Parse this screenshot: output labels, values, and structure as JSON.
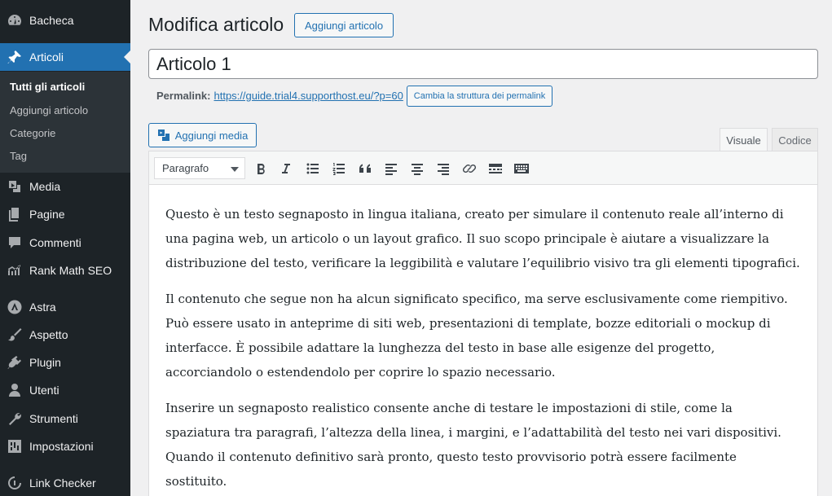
{
  "sidebar": {
    "items": [
      {
        "label": "Bacheca",
        "icon": "dashboard-icon"
      },
      {
        "label": "Articoli",
        "icon": "pin-icon"
      },
      {
        "label": "Media",
        "icon": "media-icon"
      },
      {
        "label": "Pagine",
        "icon": "pages-icon"
      },
      {
        "label": "Commenti",
        "icon": "comments-icon"
      },
      {
        "label": "Rank Math SEO",
        "icon": "chart-icon"
      },
      {
        "label": "Astra",
        "icon": "astra-icon"
      },
      {
        "label": "Aspetto",
        "icon": "brush-icon"
      },
      {
        "label": "Plugin",
        "icon": "plugin-icon"
      },
      {
        "label": "Utenti",
        "icon": "user-icon"
      },
      {
        "label": "Strumenti",
        "icon": "wrench-icon"
      },
      {
        "label": "Impostazioni",
        "icon": "settings-icon"
      },
      {
        "label": "Link Checker",
        "icon": "link-icon"
      }
    ],
    "submenu": [
      "Tutti gli articoli",
      "Aggiungi articolo",
      "Categorie",
      "Tag"
    ]
  },
  "header": {
    "title": "Modifica articolo",
    "add_new_label": "Aggiungi articolo"
  },
  "post": {
    "title_value": "Articolo 1",
    "permalink_label": "Permalink:",
    "permalink_url": "https://guide.trial4.supporthost.eu/?p=60",
    "change_permalink_label": "Cambia la struttura dei permalink"
  },
  "editor": {
    "add_media_label": "Aggiungi media",
    "tab_visual": "Visuale",
    "tab_code": "Codice",
    "format_value": "Paragrafo",
    "paragraphs": [
      "Questo è un testo segnaposto in lingua italiana, creato per simulare il contenuto reale all’interno di una pagina web, un articolo o un layout grafico. Il suo scopo principale è aiutare a visualizzare la distribuzione del testo, verificare la leggibilità e valutare l’equilibrio visivo tra gli elementi tipografici.",
      "Il contenuto che segue non ha alcun significato specifico, ma serve esclusivamente come riempitivo. Può essere usato in anteprime di siti web, presentazioni di template, bozze editoriali o mockup di interfacce. È possibile adattare la lunghezza del testo in base alle esigenze del progetto, accorciandolo o estendendolo per coprire lo spazio necessario.",
      "Inserire un segnaposto realistico consente anche di testare le impostazioni di stile, come la spaziatura tra paragrafi, l’altezza della linea, i margini, e l’adattabilità del testo nei vari dispositivi. Quando il contenuto definitivo sarà pronto, questo testo provvisorio potrà essere facilmente sostituito."
    ]
  },
  "colors": {
    "accent": "#2271b1",
    "sidebar_bg": "#1d2327",
    "page_bg": "#f0f0f1"
  }
}
